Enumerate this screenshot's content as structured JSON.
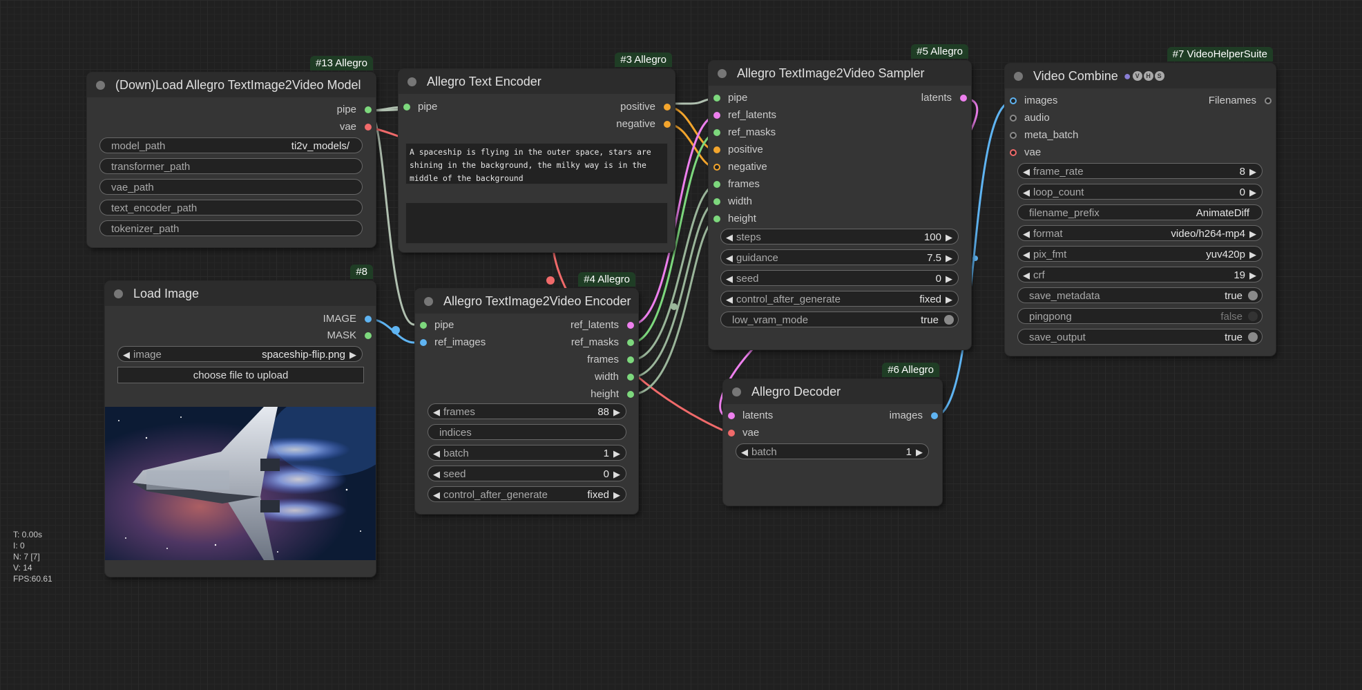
{
  "stats": {
    "t": "T: 0.00s",
    "i": "I: 0",
    "n": "N: 7 [7]",
    "v": "V: 14",
    "fps": "FPS:60.61"
  },
  "colors": {
    "pipe": "#7dd87d",
    "vae": "#f06a6a",
    "latent": "#ee80ee",
    "conditioning": "#f3a52d",
    "image": "#5fb4f2",
    "int": "#9ab59a",
    "badge": "#1f3d25"
  },
  "load_model": {
    "badge": "#13 Allegro",
    "title": "(Down)Load Allegro TextImage2Video Model",
    "out_pipe": "pipe",
    "out_vae": "vae",
    "model_path_label": "model_path",
    "model_path_value": "ti2v_models/",
    "transformer_path_label": "transformer_path",
    "vae_path_label": "vae_path",
    "text_encoder_path_label": "text_encoder_path",
    "tokenizer_path_label": "tokenizer_path"
  },
  "text_encoder": {
    "badge": "#3 Allegro",
    "title": "Allegro Text Encoder",
    "in_pipe": "pipe",
    "out_positive": "positive",
    "out_negative": "negative",
    "positive_text": "A spaceship is flying in the outer space, stars are shining in the background, the milky way is in the middle of the background",
    "negative_text": ""
  },
  "load_image": {
    "badge": "#8",
    "title": "Load Image",
    "out_image": "IMAGE",
    "out_mask": "MASK",
    "image_label": "image",
    "image_value": "spaceship-flip.png",
    "upload_label": "choose file to upload",
    "preview_icon": "spaceship-preview-image"
  },
  "encoder": {
    "badge": "#4 Allegro",
    "title": "Allegro TextImage2Video Encoder",
    "in_pipe": "pipe",
    "in_ref_images": "ref_images",
    "out_ref_latents": "ref_latents",
    "out_ref_masks": "ref_masks",
    "out_frames": "frames",
    "out_width": "width",
    "out_height": "height",
    "frames_label": "frames",
    "frames_value": "88",
    "indices_label": "indices",
    "batch_label": "batch",
    "batch_value": "1",
    "seed_label": "seed",
    "seed_value": "0",
    "cag_label": "control_after_generate",
    "cag_value": "fixed"
  },
  "sampler": {
    "badge": "#5 Allegro",
    "title": "Allegro TextImage2Video Sampler",
    "in_pipe": "pipe",
    "in_ref_latents": "ref_latents",
    "in_ref_masks": "ref_masks",
    "in_positive": "positive",
    "in_negative": "negative",
    "in_frames": "frames",
    "in_width": "width",
    "in_height": "height",
    "out_latents": "latents",
    "steps_label": "steps",
    "steps_value": "100",
    "guidance_label": "guidance",
    "guidance_value": "7.5",
    "seed_label": "seed",
    "seed_value": "0",
    "cag_label": "control_after_generate",
    "cag_value": "fixed",
    "low_vram_label": "low_vram_mode",
    "low_vram_value": "true"
  },
  "decoder": {
    "badge": "#6 Allegro",
    "title": "Allegro Decoder",
    "in_latents": "latents",
    "in_vae": "vae",
    "out_images": "images",
    "batch_label": "batch",
    "batch_value": "1"
  },
  "video_combine": {
    "badge": "#7 VideoHelperSuite",
    "title": "Video Combine",
    "title_icons": [
      "V",
      "H",
      "S"
    ],
    "in_images": "images",
    "in_audio": "audio",
    "in_meta_batch": "meta_batch",
    "in_vae": "vae",
    "out_filenames": "Filenames",
    "frame_rate_label": "frame_rate",
    "frame_rate_value": "8",
    "loop_count_label": "loop_count",
    "loop_count_value": "0",
    "filename_prefix_label": "filename_prefix",
    "filename_prefix_value": "AnimateDiff",
    "format_label": "format",
    "format_value": "video/h264-mp4",
    "pix_fmt_label": "pix_fmt",
    "pix_fmt_value": "yuv420p",
    "crf_label": "crf",
    "crf_value": "19",
    "save_metadata_label": "save_metadata",
    "save_metadata_value": "true",
    "pingpong_label": "pingpong",
    "pingpong_value": "false",
    "save_output_label": "save_output",
    "save_output_value": "true"
  }
}
